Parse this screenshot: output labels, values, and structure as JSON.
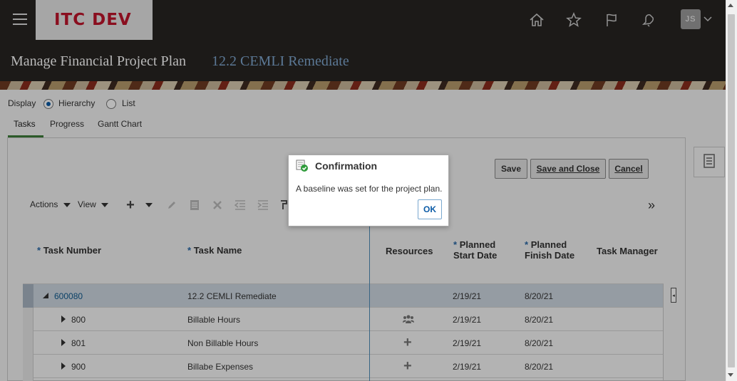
{
  "app": {
    "brand": "ITC DEV",
    "user_initials": "JS"
  },
  "header": {
    "title": "Manage Financial Project Plan",
    "subtitle": "12.2 CEMLI Remediate"
  },
  "display": {
    "label": "Display",
    "options": [
      {
        "label": "Hierarchy",
        "selected": true
      },
      {
        "label": "List",
        "selected": false
      }
    ]
  },
  "tabs": [
    {
      "label": "Tasks",
      "active": true
    },
    {
      "label": "Progress",
      "active": false
    },
    {
      "label": "Gantt Chart",
      "active": false
    }
  ],
  "actions": {
    "save": "Save",
    "save_and_close": "Save and Close",
    "cancel": "Cancel"
  },
  "toolbar": {
    "actions": "Actions",
    "view": "View",
    "overflow": "»"
  },
  "table": {
    "columns": {
      "task_number": "Task Number",
      "task_name": "Task Name",
      "resources": "Resources",
      "planned_start_1": "Planned",
      "planned_start_2": "Start Date",
      "planned_finish_1": "Planned",
      "planned_finish_2": "Finish Date",
      "task_manager": "Task Manager",
      "required_marker": "*"
    },
    "rows": [
      {
        "number": "600080",
        "name": "12.2 CEMLI Remediate",
        "start": "2/19/21",
        "finish": "8/20/21",
        "resource_icon": ""
      },
      {
        "number": "800",
        "name": "Billable Hours",
        "start": "2/19/21",
        "finish": "8/20/21",
        "resource_icon": "people-icon"
      },
      {
        "number": "801",
        "name": "Non Billable Hours",
        "start": "2/19/21",
        "finish": "8/20/21",
        "resource_icon": "plus-icon"
      },
      {
        "number": "900",
        "name": "Billabe Expenses",
        "start": "2/19/21",
        "finish": "8/20/21",
        "resource_icon": "plus-icon"
      }
    ]
  },
  "dialog": {
    "title": "Confirmation",
    "message": "A baseline was set for the project plan.",
    "ok": "OK"
  },
  "colors": {
    "accent": "#0c5ca7",
    "brand_red": "#c0142b",
    "header_bg": "#272422",
    "selected_row": "#cfd8e2"
  }
}
